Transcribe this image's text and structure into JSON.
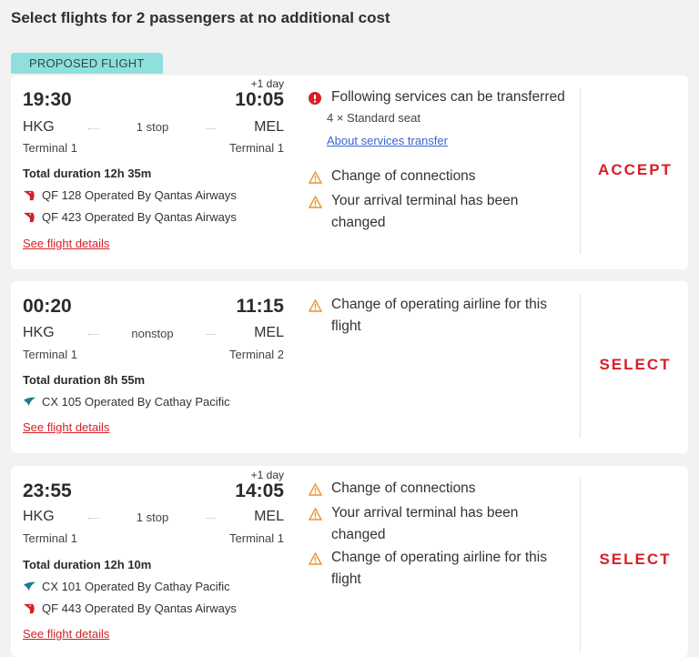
{
  "page": {
    "title": "Select flights for 2 passengers at no additional cost"
  },
  "badge": {
    "label": "PROPOSED FLIGHT"
  },
  "colors": {
    "accent_red": "#d61f26",
    "badge_bg": "#8fe0dc",
    "link_blue": "#3b64d1",
    "warning_orange": "#e8962e"
  },
  "options": [
    {
      "departure_time": "19:30",
      "arrival_time": "10:05",
      "plus_day": "+1 day",
      "origin": "HKG",
      "destination": "MEL",
      "stops": "1 stop",
      "origin_terminal": "Terminal 1",
      "destination_terminal": "Terminal 1",
      "duration": "Total duration 12h 35m",
      "flights": [
        {
          "airline_icon": "qantas-logo",
          "text": "QF 128 Operated By Qantas Airways"
        },
        {
          "airline_icon": "qantas-logo",
          "text": "QF 423 Operated By Qantas Airways"
        }
      ],
      "details_link": "See flight details",
      "info_notice": "Following services can be transferred",
      "info_sub": "4 × Standard seat",
      "info_link": "About services transfer",
      "warnings": [
        "Change of connections",
        "Your arrival terminal has been changed"
      ],
      "action": "ACCEPT"
    },
    {
      "departure_time": "00:20",
      "arrival_time": "11:15",
      "origin": "HKG",
      "destination": "MEL",
      "stops": "nonstop",
      "origin_terminal": "Terminal 1",
      "destination_terminal": "Terminal 2",
      "duration": "Total duration 8h 55m",
      "flights": [
        {
          "airline_icon": "cathay-logo",
          "text": "CX 105 Operated By Cathay Pacific"
        }
      ],
      "details_link": "See flight details",
      "warnings": [
        "Change of operating airline for this flight"
      ],
      "action": "SELECT"
    },
    {
      "departure_time": "23:55",
      "arrival_time": "14:05",
      "plus_day": "+1 day",
      "origin": "HKG",
      "destination": "MEL",
      "stops": "1 stop",
      "origin_terminal": "Terminal 1",
      "destination_terminal": "Terminal 1",
      "duration": "Total duration 12h 10m",
      "flights": [
        {
          "airline_icon": "cathay-logo",
          "text": "CX 101 Operated By Cathay Pacific"
        },
        {
          "airline_icon": "qantas-logo",
          "text": "QF 443 Operated By Qantas Airways"
        }
      ],
      "details_link": "See flight details",
      "warnings": [
        "Change of connections",
        "Your arrival terminal has been changed",
        "Change of operating airline for this flight"
      ],
      "action": "SELECT"
    }
  ]
}
